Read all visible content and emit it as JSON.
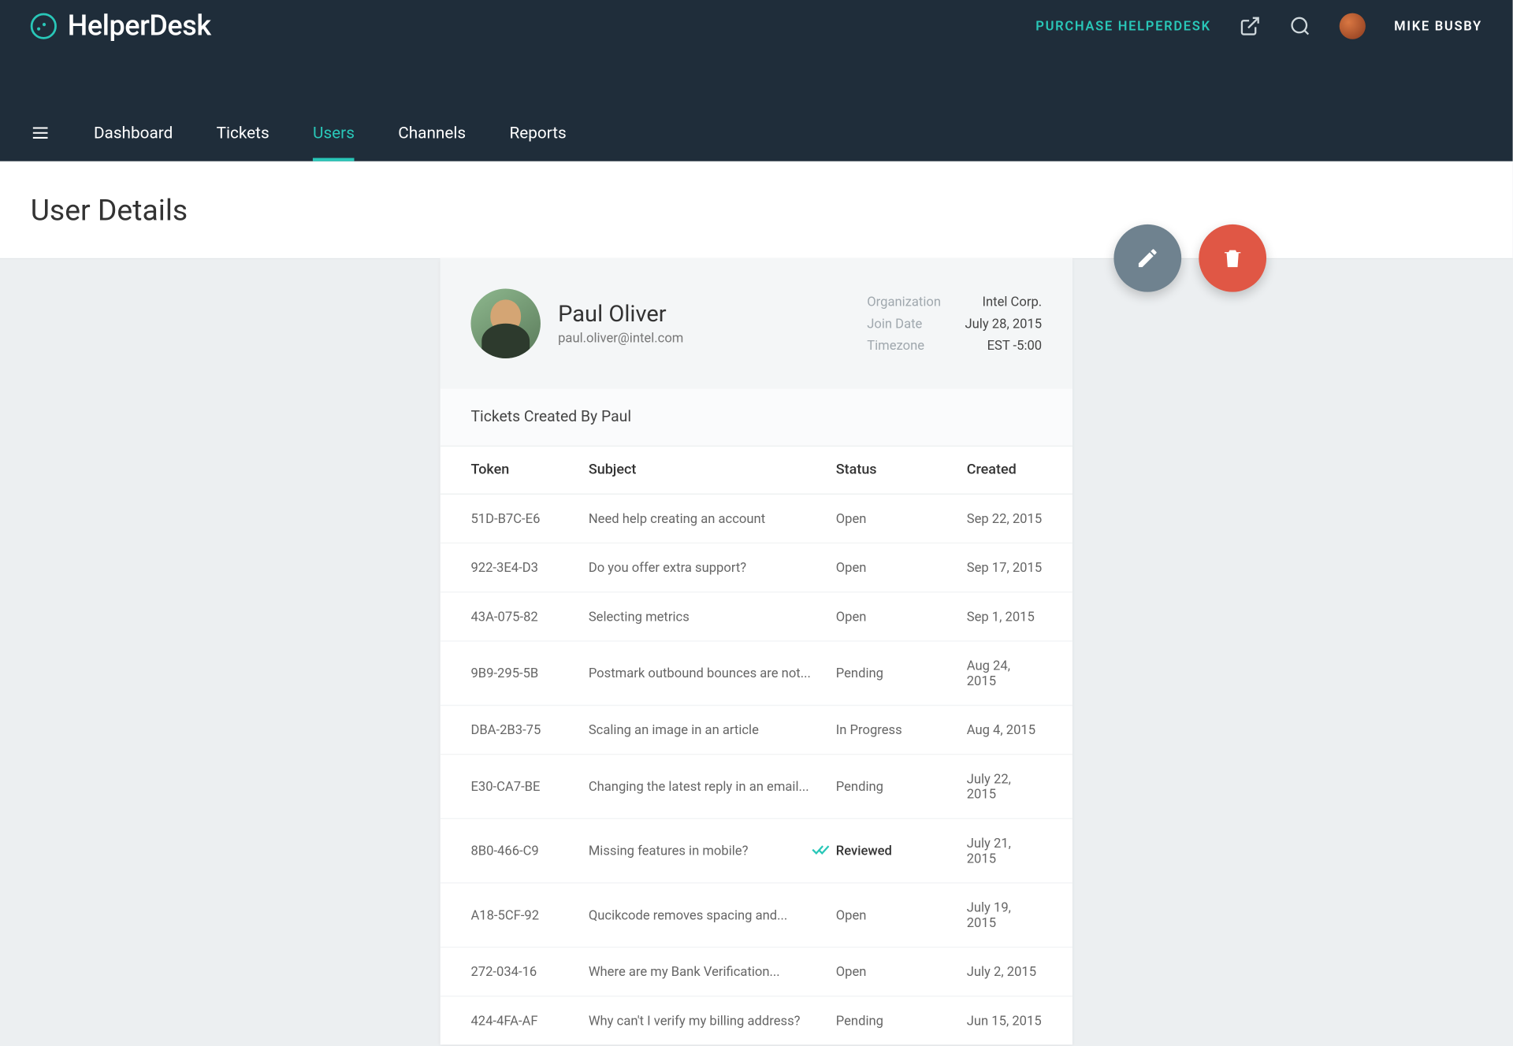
{
  "brand": "HelperDesk",
  "header": {
    "purchase": "PURCHASE HELPERDESK",
    "username": "MIKE BUSBY"
  },
  "nav": {
    "items": [
      "Dashboard",
      "Tickets",
      "Users",
      "Channels",
      "Reports"
    ],
    "active_index": 2
  },
  "page_title": "User Details",
  "user": {
    "name": "Paul Oliver",
    "email": "paul.oliver@intel.com",
    "meta": {
      "org_label": "Organization",
      "org_value": "Intel Corp.",
      "join_label": "Join Date",
      "join_value": "July 28, 2015",
      "tz_label": "Timezone",
      "tz_value": "EST -5:00"
    }
  },
  "tickets": {
    "section_title": "Tickets Created By Paul",
    "columns": {
      "token": "Token",
      "subject": "Subject",
      "status": "Status",
      "created": "Created"
    },
    "rows": [
      {
        "token": "51D-B7C-E6",
        "subject": "Need help creating an account",
        "status": "Open",
        "created": "Sep 22, 2015",
        "reviewed": false
      },
      {
        "token": "922-3E4-D3",
        "subject": "Do you offer extra support?",
        "status": "Open",
        "created": "Sep 17, 2015",
        "reviewed": false
      },
      {
        "token": "43A-075-82",
        "subject": "Selecting metrics",
        "status": "Open",
        "created": "Sep 1, 2015",
        "reviewed": false
      },
      {
        "token": "9B9-295-5B",
        "subject": "Postmark outbound bounces are not...",
        "status": "Pending",
        "created": "Aug 24, 2015",
        "reviewed": false
      },
      {
        "token": "DBA-2B3-75",
        "subject": "Scaling an image in an article",
        "status": "In Progress",
        "created": "Aug 4, 2015",
        "reviewed": false
      },
      {
        "token": "E30-CA7-BE",
        "subject": "Changing the latest reply in an email...",
        "status": "Pending",
        "created": "July 22, 2015",
        "reviewed": false
      },
      {
        "token": "8B0-466-C9",
        "subject": "Missing features in mobile?",
        "status": "Reviewed",
        "created": "July 21, 2015",
        "reviewed": true
      },
      {
        "token": "A18-5CF-92",
        "subject": "Qucikcode removes spacing and...",
        "status": "Open",
        "created": "July 19, 2015",
        "reviewed": false
      },
      {
        "token": "272-034-16",
        "subject": "Where are my Bank Verification...",
        "status": "Open",
        "created": "July 2, 2015",
        "reviewed": false
      },
      {
        "token": "424-4FA-AF",
        "subject": "Why can't I verify my billing address?",
        "status": "Pending",
        "created": "Jun 15, 2015",
        "reviewed": false
      }
    ]
  }
}
